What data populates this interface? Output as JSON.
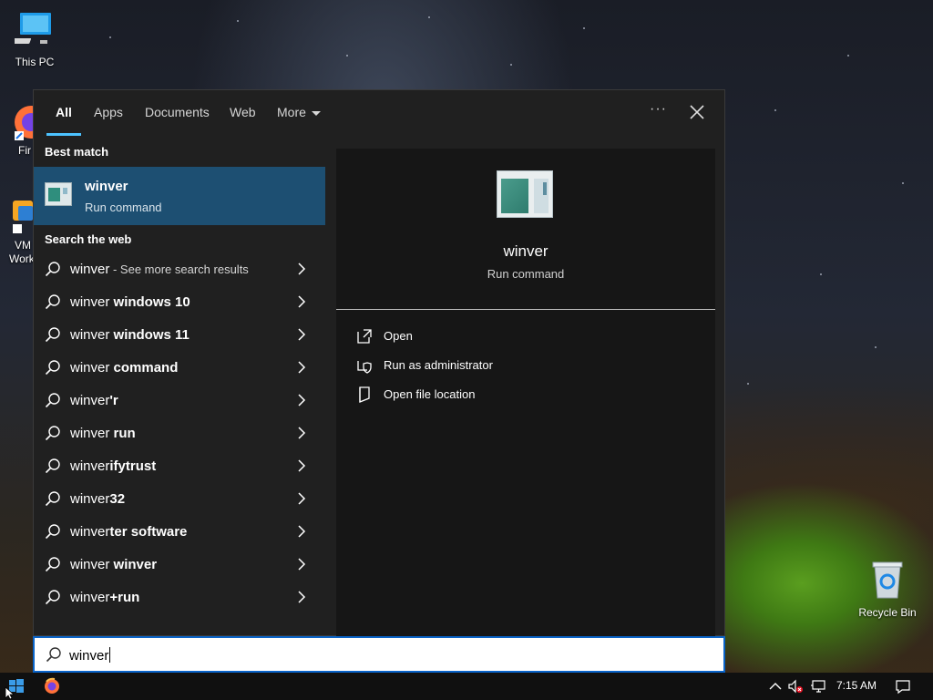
{
  "desktop": {
    "this_pc_label": "This PC",
    "firefox_partial_label": "Fir",
    "vmware_partial_label_line1": "VM",
    "vmware_partial_label_line2": "Work",
    "recycle_bin_label": "Recycle Bin"
  },
  "search_panel": {
    "tabs": [
      {
        "label": "All",
        "active": true
      },
      {
        "label": "Apps"
      },
      {
        "label": "Documents"
      },
      {
        "label": "Web"
      },
      {
        "label": "More"
      }
    ],
    "options_glyph": "···",
    "best_match_heading": "Best match",
    "best_match": {
      "title": "winver",
      "subtitle": "Run command",
      "icon": "run-command-window-icon"
    },
    "web_heading": "Search the web",
    "web_results": [
      {
        "typed": "winver",
        "completion": "",
        "hint": " - See more search results"
      },
      {
        "typed": "winver",
        "completion": " windows 10",
        "hint": ""
      },
      {
        "typed": "winver",
        "completion": " windows 11",
        "hint": ""
      },
      {
        "typed": "winver",
        "completion": " command",
        "hint": ""
      },
      {
        "typed": "winver",
        "completion": "'r",
        "hint": ""
      },
      {
        "typed": "winver",
        "completion": " run",
        "hint": ""
      },
      {
        "typed": "winver",
        "completion": "ifytrust",
        "hint": ""
      },
      {
        "typed": "winver",
        "completion": "32",
        "hint": ""
      },
      {
        "typed": "winver",
        "completion": "ter software",
        "hint": ""
      },
      {
        "typed": "winver",
        "completion": " winver",
        "hint": ""
      },
      {
        "typed": "winver",
        "completion": "+run",
        "hint": ""
      }
    ],
    "preview": {
      "title": "winver",
      "subtitle": "Run command",
      "actions": [
        {
          "label": "Open",
          "icon": "open-icon"
        },
        {
          "label": "Run as administrator",
          "icon": "shield-icon"
        },
        {
          "label": "Open file location",
          "icon": "file-location-icon"
        }
      ]
    },
    "search_input": {
      "value": "winver"
    }
  },
  "taskbar": {
    "time": "7:15 AM",
    "accent": "#4cc2ff",
    "selected_bg": "#1d4f72"
  }
}
